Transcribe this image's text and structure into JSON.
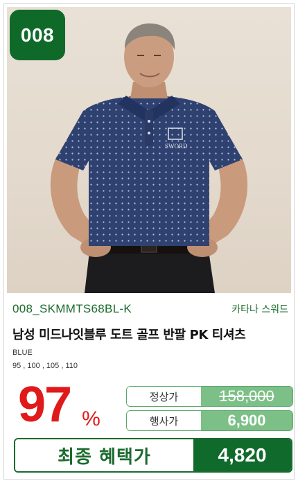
{
  "product": {
    "number_badge": "008",
    "code": "008_SKMMTS68BL-K",
    "brand": "카타나 스워드",
    "title": "남성 미드나잇블루 도트 골프 반팔 PK 티셔츠",
    "color": "BLUE",
    "sizes": "95 , 100 , 105 , 110",
    "image_alt": "man wearing navy dot polo shirt",
    "shirt_logo_text": "SWORD"
  },
  "pricing": {
    "discount_value": "97",
    "discount_unit": "%",
    "regular_label": "정상가",
    "regular_price": "158,000",
    "sale_label": "행사가",
    "sale_price": "6,900",
    "final_label": "최종 혜택가",
    "final_price": "4,820"
  },
  "colors": {
    "brand_green": "#1b6b2e",
    "light_green": "#7cc087",
    "discount_red": "#e01a1a",
    "shirt_navy": "#2c3e6b"
  }
}
